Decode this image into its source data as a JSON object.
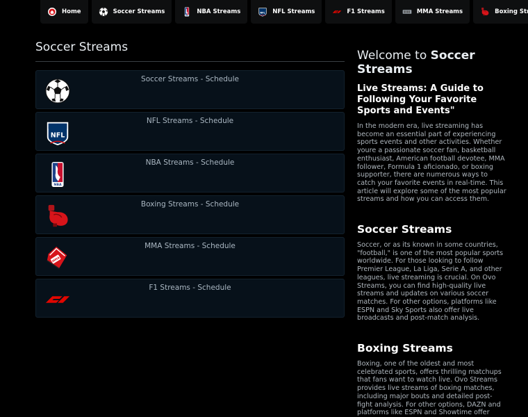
{
  "nav": {
    "items": [
      {
        "label": "Home",
        "icon": "home-icon"
      },
      {
        "label": "Soccer Streams",
        "icon": "soccer-ball-icon"
      },
      {
        "label": "NBA Streams",
        "icon": "nba-logo-icon"
      },
      {
        "label": "NFL Streams",
        "icon": "nfl-logo-icon"
      },
      {
        "label": "F1 Streams",
        "icon": "f1-logo-icon"
      },
      {
        "label": "MMA Streams",
        "icon": "mma-glove-icon"
      },
      {
        "label": "Boxing Streams",
        "icon": "boxing-glove-icon"
      }
    ]
  },
  "main": {
    "title": "Soccer Streams",
    "cards": [
      {
        "label": "Soccer Streams - Schedule",
        "icon": "soccer-ball-icon"
      },
      {
        "label": "NFL Streams - Schedule",
        "icon": "nfl-logo-icon"
      },
      {
        "label": "NBA Streams - Schedule",
        "icon": "nba-logo-icon"
      },
      {
        "label": "Boxing Streams - Schedule",
        "icon": "boxing-glove-icon"
      },
      {
        "label": "MMA Streams - Schedule",
        "icon": "mma-glove-icon"
      },
      {
        "label": "F1 Streams - Schedule",
        "icon": "f1-logo-icon"
      }
    ]
  },
  "aside": {
    "welcome_prefix": "Welcome to ",
    "welcome_bold": "Soccer Streams",
    "guide_title": "Live Streams: A Guide to Following Your Favorite Sports and Events\"",
    "intro": "In the modern era, live streaming has become an essential part of experiencing sports events and other activities. Whether youre a passionate soccer fan, basketball enthusiast, American football devotee, MMA follower, Formula 1 aficionado, or boxing supporter, there are numerous ways to catch your favorite events in real-time. This article will explore some of the most popular streams and how you can access them.",
    "soccer_heading": "Soccer Streams",
    "soccer_text": "Soccer, or as its known in some countries, \"football,\" is one of the most popular sports worldwide. For those looking to follow Premier League, La Liga, Serie A, and other leagues, live streaming is crucial. On Ovo Streams, you can find high-quality live streams and updates on various soccer matches. For other options, platforms like ESPN and Sky Sports also offer live broadcasts and post-match analysis.",
    "boxing_heading": "Boxing Streams",
    "boxing_text": "Boxing, one of the oldest and most celebrated sports, offers thrilling matchups that fans want to watch live. Ovo Streams provides live streams of boxing matches, including major bouts and detailed post-fight analysis. For other options, DAZN and platforms like ESPN and Showtime offer extensive live coverage of boxing events."
  },
  "colors": {
    "accent_red": "#d7141a",
    "nfl_blue": "#013369",
    "nba_blue": "#1d428a"
  }
}
